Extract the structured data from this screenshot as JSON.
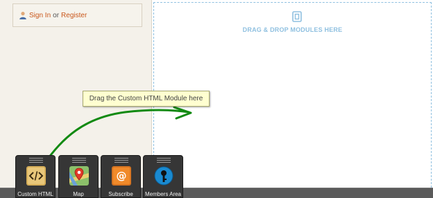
{
  "sidebar": {
    "sign_in": "Sign In",
    "or": "or",
    "register": "Register"
  },
  "dropzone": {
    "label": "DRAG & DROP MODULES HERE"
  },
  "hint": {
    "text": "Drag the Custom HTML Module here"
  },
  "modules": [
    {
      "label": "Custom HTML",
      "icon": "code-icon"
    },
    {
      "label": "Map",
      "icon": "map-pin-icon"
    },
    {
      "label": "Subscribe",
      "icon": "at-sign-icon"
    },
    {
      "label": "Members Area",
      "icon": "key-icon"
    }
  ],
  "colors": {
    "link": "#c9561a",
    "dropzone": "#8fc0e0",
    "arrow": "#128a12",
    "hint_bg": "#ffffd0"
  }
}
